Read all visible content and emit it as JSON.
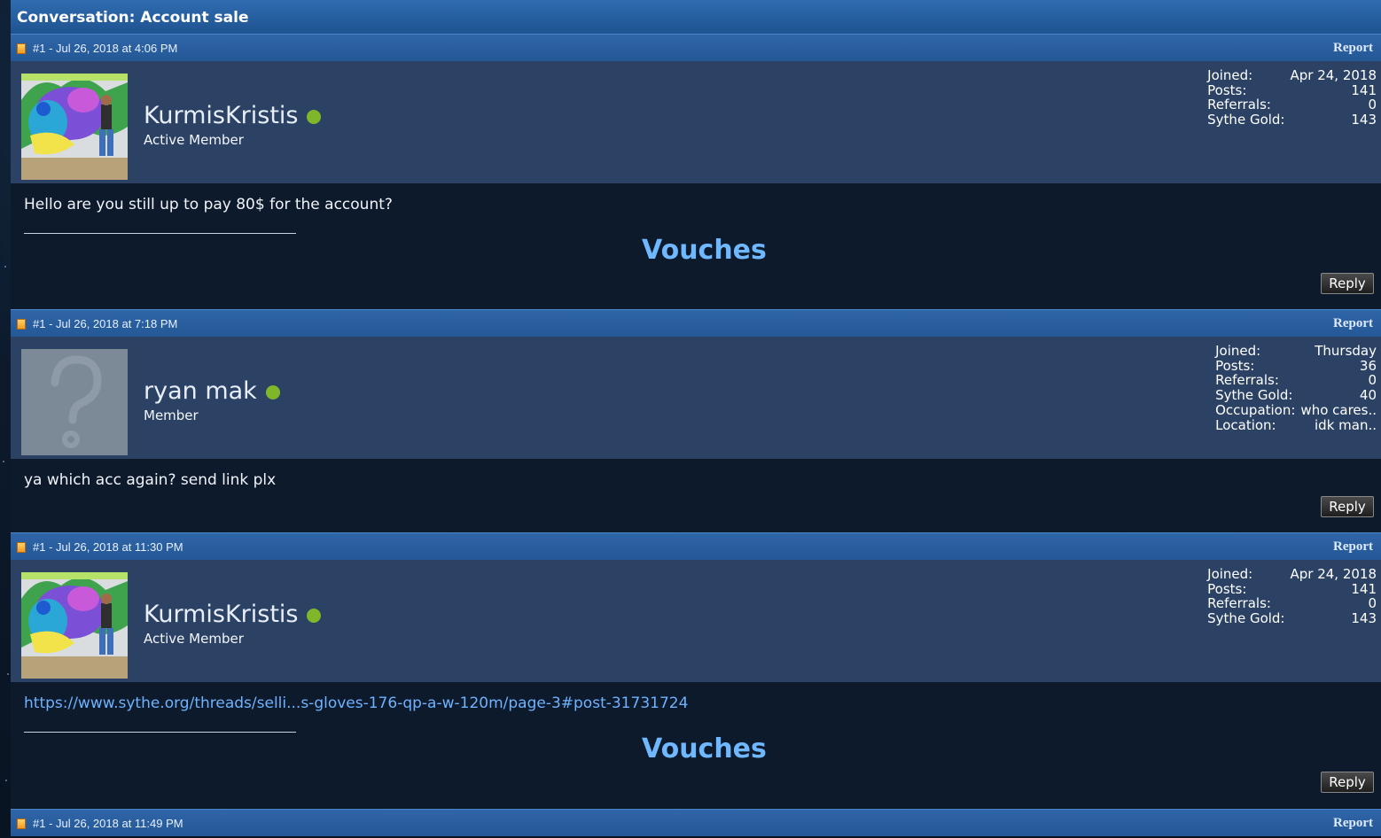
{
  "conversation_title": "Conversation: Account sale",
  "posts": [
    {
      "date": "#1 - Jul 26, 2018 at 4:06 PM",
      "report": "Report",
      "username": "KurmisKristis",
      "role": "Active Member",
      "avatar": "graffiti-photo",
      "stats": [
        {
          "k": "Joined:",
          "v": "Apr 24, 2018"
        },
        {
          "k": "Posts:",
          "v": "141"
        },
        {
          "k": "Referrals:",
          "v": "0"
        },
        {
          "k": "Sythe Gold:",
          "v": "143"
        }
      ],
      "message": "Hello are you still up to pay 80$ for the account?",
      "signature": "Vouches",
      "reply": "Reply"
    },
    {
      "date": "#1 - Jul 26, 2018 at 7:18 PM",
      "report": "Report",
      "username": "ryan mak",
      "role": "Member",
      "avatar": "default-question-mark",
      "stats": [
        {
          "k": "Joined:",
          "v": "Thursday"
        },
        {
          "k": "Posts:",
          "v": "36"
        },
        {
          "k": "Referrals:",
          "v": "0"
        },
        {
          "k": "Sythe Gold:",
          "v": "40"
        },
        {
          "k": "Occupation:",
          "v": "who cares.."
        },
        {
          "k": "Location:",
          "v": "idk man.."
        }
      ],
      "message": "ya which acc again? send link plx",
      "reply": "Reply"
    },
    {
      "date": "#1 - Jul 26, 2018 at 11:30 PM",
      "report": "Report",
      "username": "KurmisKristis",
      "role": "Active Member",
      "avatar": "graffiti-photo",
      "stats": [
        {
          "k": "Joined:",
          "v": "Apr 24, 2018"
        },
        {
          "k": "Posts:",
          "v": "141"
        },
        {
          "k": "Referrals:",
          "v": "0"
        },
        {
          "k": "Sythe Gold:",
          "v": "143"
        }
      ],
      "message_link": "https://www.sythe.org/threads/selli...s-gloves-176-qp-a-w-120m/page-3#post-31731724",
      "signature": "Vouches",
      "reply": "Reply"
    },
    {
      "date": "#1 - Jul 26, 2018 at 11:49 PM",
      "report": "Report"
    }
  ],
  "colors": {
    "header_blue": "#2f66a8",
    "user_bar": "#2c4264",
    "body_dark": "#0d1a2b",
    "online_green": "#7fb62a",
    "vouches_blue": "#6fb8ff"
  }
}
